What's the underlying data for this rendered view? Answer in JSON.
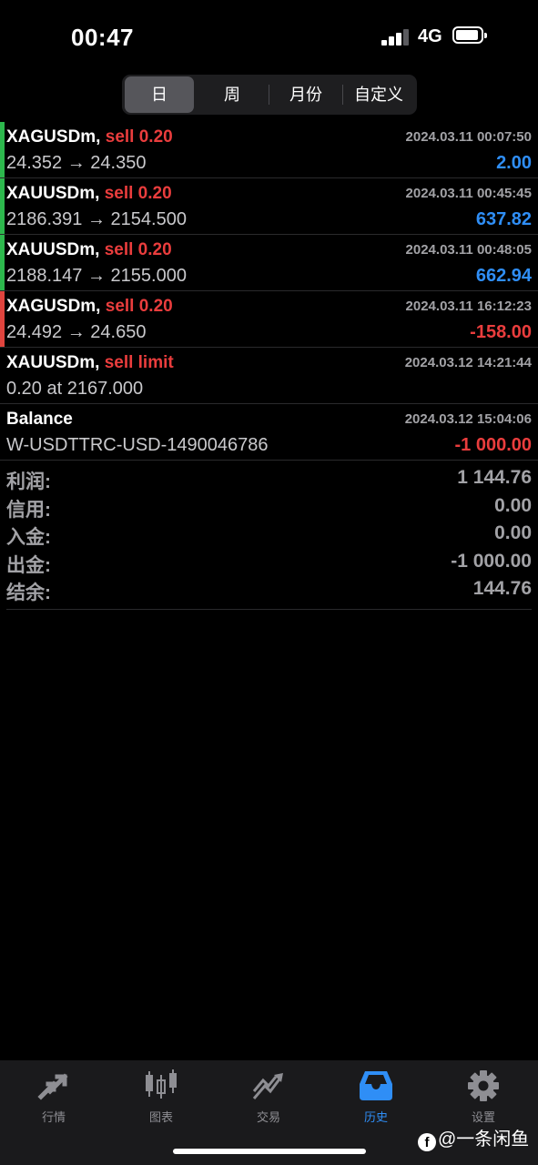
{
  "status_bar": {
    "time": "00:47",
    "network": "4G"
  },
  "period_tabs": [
    {
      "label": "日",
      "active": true
    },
    {
      "label": "周",
      "active": false
    },
    {
      "label": "月份",
      "active": false
    },
    {
      "label": "自定义",
      "active": false
    }
  ],
  "deals": [
    {
      "symbol": "XAGUSDm,",
      "action": "sell 0.20",
      "datetime": "2024.03.11 00:07:50",
      "prices": "24.352 → 24.350",
      "profit": "2.00",
      "profit_sign": "positive",
      "marker_color": "#2db84d"
    },
    {
      "symbol": "XAUUSDm,",
      "action": "sell 0.20",
      "datetime": "2024.03.11 00:45:45",
      "prices": "2186.391 → 2154.500",
      "profit": "637.82",
      "profit_sign": "positive",
      "marker_color": "#2db84d"
    },
    {
      "symbol": "XAUUSDm,",
      "action": "sell 0.20",
      "datetime": "2024.03.11 00:48:05",
      "prices": "2188.147 → 2155.000",
      "profit": "662.94",
      "profit_sign": "positive",
      "marker_color": "#2db84d"
    },
    {
      "symbol": "XAGUSDm,",
      "action": "sell 0.20",
      "datetime": "2024.03.11 16:12:23",
      "prices": "24.492 → 24.650",
      "profit": "-158.00",
      "profit_sign": "negative",
      "marker_color": "#e0443e"
    },
    {
      "symbol": "XAUUSDm,",
      "action": "sell limit",
      "datetime": "2024.03.12 14:21:44",
      "prices": "0.20 at 2167.000",
      "profit": "",
      "profit_sign": "none",
      "marker_color": ""
    },
    {
      "symbol": "Balance",
      "action": "",
      "datetime": "2024.03.12 15:04:06",
      "prices": "W-USDTTRC-USD-1490046786",
      "profit": "-1 000.00",
      "profit_sign": "negative",
      "marker_color": ""
    }
  ],
  "summary": [
    {
      "label": "利润:",
      "value": "1 144.76"
    },
    {
      "label": "信用:",
      "value": "0.00"
    },
    {
      "label": "入金:",
      "value": "0.00"
    },
    {
      "label": "出金:",
      "value": "-1 000.00"
    },
    {
      "label": "结余:",
      "value": "144.76"
    }
  ],
  "tabbar": [
    {
      "label": "行情",
      "icon": "quotes-icon",
      "active": false
    },
    {
      "label": "图表",
      "icon": "candlestick-chart-icon",
      "active": false
    },
    {
      "label": "交易",
      "icon": "trade-icon",
      "active": false
    },
    {
      "label": "历史",
      "icon": "history-inbox-icon",
      "active": true
    },
    {
      "label": "设置",
      "icon": "gear-icon",
      "active": false
    }
  ],
  "watermark": {
    "text": "@一条闲鱼",
    "icon": "facebook-icon"
  },
  "colors": {
    "positive": "#2f8ef6",
    "negative": "#ea3d3d",
    "accent": "#2f8ef6",
    "background": "#000000"
  }
}
